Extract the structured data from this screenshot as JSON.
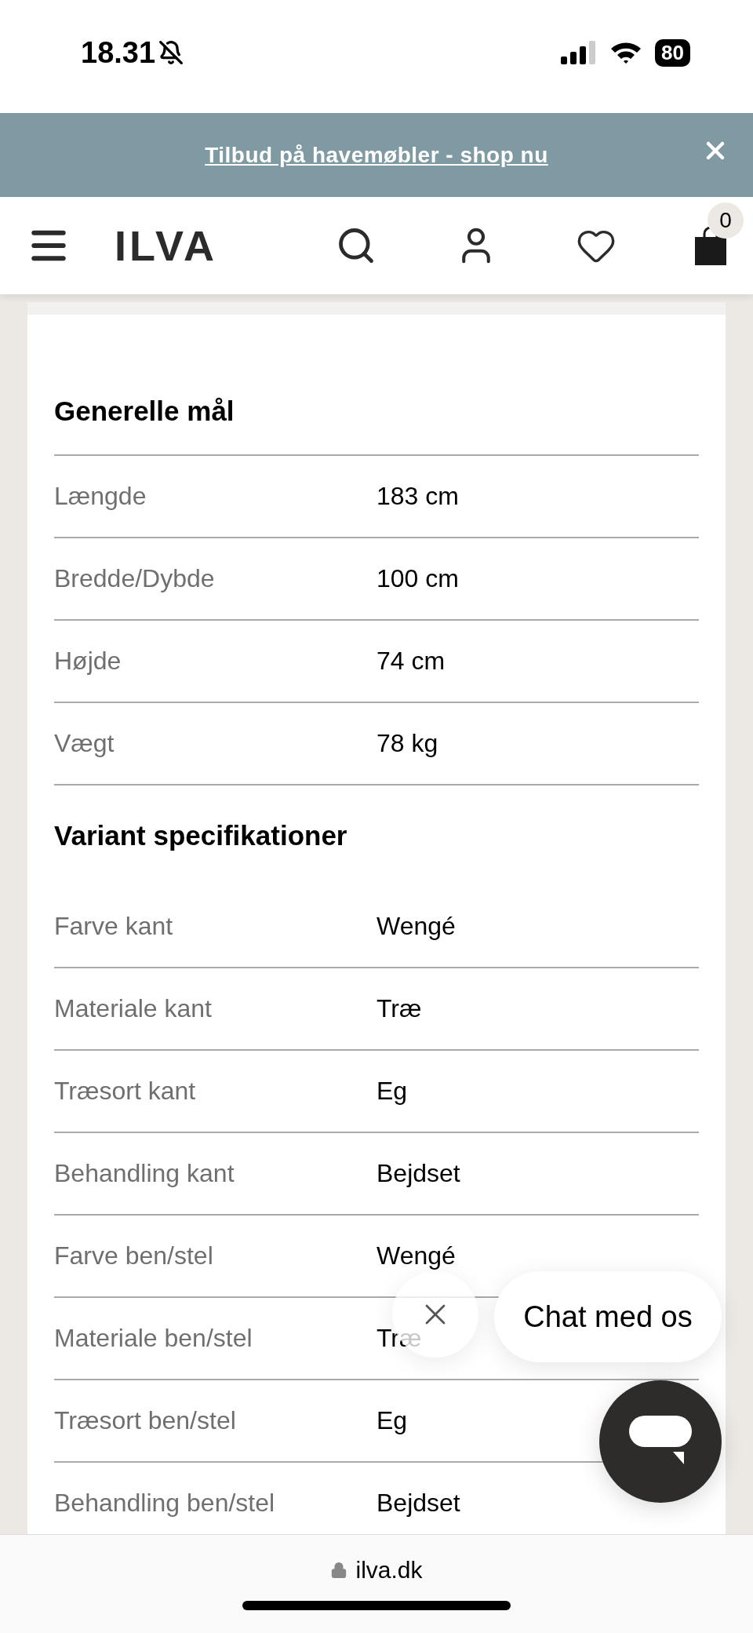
{
  "status_bar": {
    "time": "18.31",
    "battery": "80"
  },
  "banner": {
    "text": "Tilbud på havemøbler - shop nu"
  },
  "header": {
    "logo": "ILVA",
    "cart_count": "0"
  },
  "sections": [
    {
      "title": "Generelle mål",
      "rows": [
        {
          "label": "Længde",
          "value": "183 cm"
        },
        {
          "label": "Bredde/Dybde",
          "value": "100 cm"
        },
        {
          "label": "Højde",
          "value": "74 cm"
        },
        {
          "label": "Vægt",
          "value": "78 kg"
        }
      ]
    },
    {
      "title": "Variant specifikationer",
      "rows": [
        {
          "label": "Farve kant",
          "value": "Wengé"
        },
        {
          "label": "Materiale kant",
          "value": "Træ"
        },
        {
          "label": "Træsort kant",
          "value": "Eg"
        },
        {
          "label": "Behandling kant",
          "value": "Bejdset"
        },
        {
          "label": "Farve ben/stel",
          "value": "Wengé"
        },
        {
          "label": "Materiale ben/stel",
          "value": "Træ"
        },
        {
          "label": "Træsort ben/stel",
          "value": "Eg"
        },
        {
          "label": "Behandling ben/stel",
          "value": "Bejdset"
        }
      ]
    }
  ],
  "chat": {
    "label": "Chat med os"
  },
  "browser": {
    "url": "ilva.dk"
  }
}
